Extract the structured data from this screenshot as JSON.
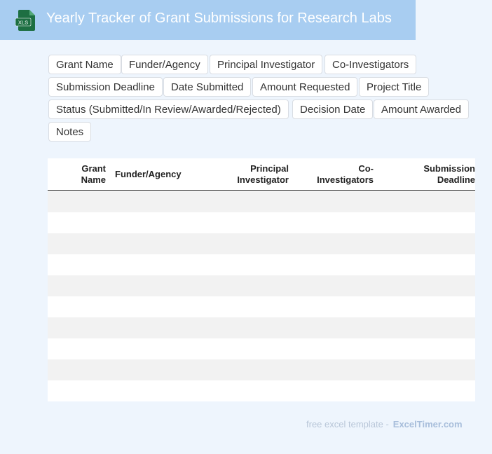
{
  "header": {
    "icon_label": "XLS",
    "title": "Yearly Tracker of Grant Submissions for Research Labs"
  },
  "fields": [
    "Grant Name",
    "Funder/Agency",
    "Principal Investigator",
    "Co-Investigators",
    "Submission Deadline",
    "Date Submitted",
    "Amount Requested",
    "Project Title",
    "Status (Submitted/In Review/Awarded/Rejected)",
    "Decision Date",
    "Amount Awarded",
    "Notes"
  ],
  "table": {
    "columns": [
      [
        "Grant",
        "Name"
      ],
      [
        "Funder/Agency"
      ],
      [
        "Principal",
        "Investigator"
      ],
      [
        "Co-",
        "Investigators"
      ],
      [
        "Submission",
        "Deadline"
      ]
    ],
    "row_count": 10
  },
  "footer": {
    "prefix": "free excel template -",
    "brand": "ExcelTimer.com"
  },
  "colors": {
    "header_bg": "#a8cdf1",
    "icon_green": "#1d6f42",
    "page_bg": "#eef5fd"
  }
}
